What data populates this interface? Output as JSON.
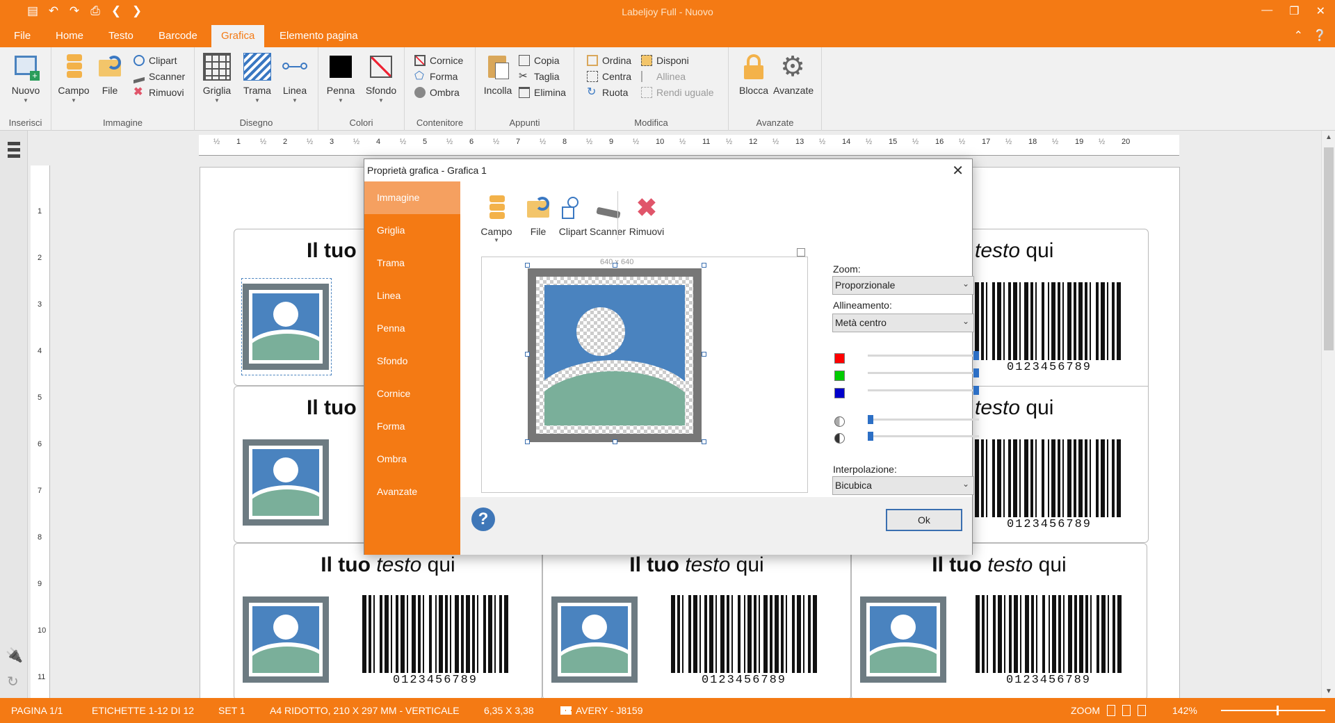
{
  "app": {
    "title": "Labeljoy Full - Nuovo"
  },
  "menu_tabs": [
    "File",
    "Home",
    "Testo",
    "Barcode",
    "Grafica",
    "Elemento pagina"
  ],
  "ribbon": {
    "inserisci": {
      "label": "Inserisci",
      "nuovo": "Nuovo"
    },
    "immagine": {
      "label": "Immagine",
      "campo": "Campo",
      "file": "File",
      "clipart": "Clipart",
      "scanner": "Scanner",
      "rimuovi": "Rimuovi"
    },
    "disegno": {
      "label": "Disegno",
      "griglia": "Griglia",
      "trama": "Trama",
      "linea": "Linea"
    },
    "colori": {
      "label": "Colori",
      "penna": "Penna",
      "sfondo": "Sfondo"
    },
    "contenitore": {
      "label": "Contenitore",
      "cornice": "Cornice",
      "forma": "Forma",
      "ombra": "Ombra"
    },
    "appunti": {
      "label": "Appunti",
      "incolla": "Incolla",
      "copia": "Copia",
      "taglia": "Taglia",
      "elimina": "Elimina"
    },
    "modifica": {
      "label": "Modifica",
      "ordina": "Ordina",
      "centra": "Centra",
      "ruota": "Ruota",
      "disponi": "Disponi",
      "allinea": "Allinea",
      "rendi_uguale": "Rendi uguale"
    },
    "avanzate": {
      "label": "Avanzate",
      "blocca": "Blocca",
      "avanzate": "Avanzate"
    }
  },
  "ruler": {
    "h_ticks": [
      "1",
      "2",
      "3",
      "4",
      "5",
      "6",
      "7",
      "8",
      "9",
      "10",
      "11",
      "12",
      "13",
      "14",
      "15",
      "16",
      "17",
      "18",
      "19",
      "20"
    ],
    "v_ticks": [
      "1",
      "2",
      "3",
      "4",
      "5",
      "6",
      "7",
      "8",
      "9",
      "10",
      "11"
    ],
    "half": "½"
  },
  "label_content": {
    "title_bold": "Il tuo",
    "title_italic": "testo",
    "title_rest": "qui",
    "title_partial_right": "testo",
    "barcode_number": "0123456789"
  },
  "dialog": {
    "title": "Proprietà grafica - Grafica 1",
    "close": "✕",
    "sidebar": [
      "Immagine",
      "Griglia",
      "Trama",
      "Linea",
      "Penna",
      "Sfondo",
      "Cornice",
      "Forma",
      "Ombra",
      "Avanzate"
    ],
    "toolbar": {
      "campo": "Campo",
      "file": "File",
      "clipart": "Clipart",
      "scanner": "Scanner",
      "rimuovi": "Rimuovi"
    },
    "size_text": "640 x 640",
    "zoom_label": "Zoom:",
    "zoom_value": "Proporzionale",
    "align_label": "Allineamento:",
    "align_value": "Metà centro",
    "interp_label": "Interpolazione:",
    "interp_value": "Bicubica",
    "sliders": {
      "red": 1.0,
      "green": 1.0,
      "blue": 1.0,
      "brightness": 0.0,
      "contrast": 0.0
    },
    "swatch_colors": {
      "red": "#ff0000",
      "green": "#00cc00",
      "blue": "#0000cc"
    },
    "ok": "Ok",
    "help": "?"
  },
  "status": {
    "pagina": "PAGINA 1/1",
    "etichette": "ETICHETTE 1-12 DI 12",
    "set": "SET 1",
    "formato": "A4 RIDOTTO, 210 X 297 MM - VERTICALE",
    "misura": "6,35 X 3,38",
    "avery": "AVERY - J8159",
    "zoom_label": "ZOOM",
    "zoom_value": "142%"
  },
  "colors": {
    "accent": "#f47a14",
    "image_blue": "#4a83bf",
    "image_green": "#7aaf9a",
    "frame_gray": "#6d7b82"
  }
}
